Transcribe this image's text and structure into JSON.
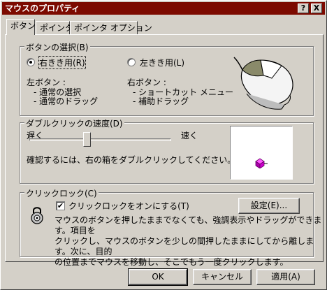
{
  "window": {
    "title": "マウスのプロパティ",
    "help_glyph": "?",
    "close_glyph": "X"
  },
  "tabs": [
    {
      "label": "ボタン",
      "active": true
    },
    {
      "label": "ポインタ",
      "active": false
    },
    {
      "label": "ポインタ オプション",
      "active": false
    }
  ],
  "button_config": {
    "group_label": "ボタンの選択(B)",
    "right_handed": {
      "label": "右きき用(R)",
      "selected": true
    },
    "left_handed": {
      "label": "左きき用(L)",
      "selected": false
    },
    "left_button": {
      "title": "左ボタン :",
      "items": [
        "- 通常の選択",
        "- 通常のドラッグ"
      ]
    },
    "right_button": {
      "title": "右ボタン :",
      "items": [
        "- ショートカット メニュー",
        "- 補助ドラッグ"
      ]
    }
  },
  "double_click": {
    "group_label": "ダブルクリックの速度(D)",
    "slow_label": "遅く",
    "fast_label": "速く",
    "slider_value": 0.4,
    "instructions": "確認するには、右の箱をダブルクリックしてください。"
  },
  "click_lock": {
    "group_label": "クリックロック(C)",
    "checkbox_label": "クリックロックをオンにする(T)",
    "checked": true,
    "settings_button": "設定(E)...",
    "description": [
      "マウスのボタンを押したままでなくても、強調表示やドラッグができます。項目を",
      "クリックし、マウスのボタンを少しの間押したままにしてから離します。次に、目的",
      "の位置までマウスを移動し、そこでもう一度クリックします。"
    ]
  },
  "footer": {
    "ok": "OK",
    "cancel": "キャンセル",
    "apply": "適用(A)"
  },
  "colors": {
    "titlebar": "#7c0a00",
    "face": "#d4d0c8",
    "test_box_item": "#cc00cc"
  }
}
